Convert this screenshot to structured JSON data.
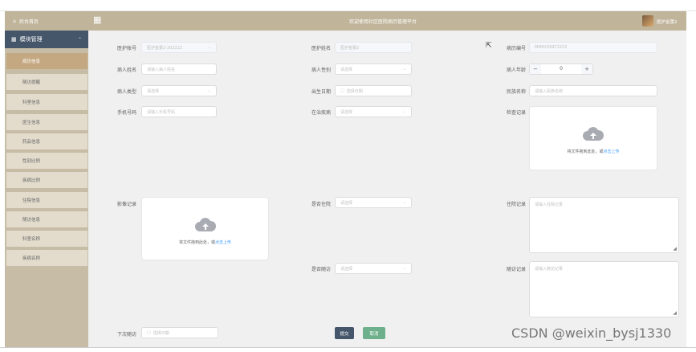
{
  "sidebar": {
    "home_label": "后台首页",
    "module_label": "模块管理",
    "items": [
      {
        "label": "病历信息",
        "active": true
      },
      {
        "label": "随访提醒",
        "active": false
      },
      {
        "label": "科室信息",
        "active": false
      },
      {
        "label": "医生信息",
        "active": false
      },
      {
        "label": "药品信息",
        "active": false
      },
      {
        "label": "性别比例",
        "active": false
      },
      {
        "label": "疾病比例",
        "active": false
      },
      {
        "label": "住院信息",
        "active": false
      },
      {
        "label": "随访信息",
        "active": false
      },
      {
        "label": "科室名称",
        "active": false
      },
      {
        "label": "疾病名称",
        "active": false
      }
    ]
  },
  "header": {
    "title": "欢迎使用社区医院病历管理平台",
    "user": "医护金蕾2"
  },
  "form": {
    "nurse_account": {
      "label": "医护账号",
      "value": "医护金蕾2-202222"
    },
    "nurse_name": {
      "label": "医护姓名",
      "value": "医护金蕾2"
    },
    "record_no": {
      "label": "病历编号",
      "value": "MM4259972222"
    },
    "patient_name": {
      "label": "病人姓名",
      "placeholder": "请输入病人姓名"
    },
    "patient_gender": {
      "label": "病人性别",
      "placeholder": "请选择"
    },
    "patient_age": {
      "label": "病人年龄",
      "value": "0",
      "minus": "−",
      "plus": "+"
    },
    "patient_type": {
      "label": "病人类型",
      "placeholder": "请选择"
    },
    "birth_date": {
      "label": "出生日期",
      "placeholder": "选择日期"
    },
    "ethnicity": {
      "label": "民族名称",
      "placeholder": "请输入民族名称"
    },
    "phone": {
      "label": "手机号码",
      "placeholder": "请输入手机号码"
    },
    "disease": {
      "label": "在治疾病",
      "placeholder": "请选择"
    },
    "exam_record": {
      "label": "检查记录",
      "upload_text": "将文件拖到此处，或",
      "upload_link": "点击上传"
    },
    "image_record": {
      "label": "影像记录",
      "upload_text": "将文件拖到此处，或",
      "upload_link": "点击上传"
    },
    "is_hospitalized": {
      "label": "是否住院",
      "placeholder": "请选择"
    },
    "hospital_record": {
      "label": "住院记录",
      "placeholder": "请输入住院记录"
    },
    "is_followup": {
      "label": "是否随访",
      "placeholder": "请选择"
    },
    "followup_record": {
      "label": "随访记录",
      "placeholder": "请输入随访记录"
    },
    "next_followup": {
      "label": "下次随访",
      "placeholder": "选择日期"
    },
    "submit_label": "提交",
    "cancel_label": "取消"
  },
  "icons": {
    "home": "home-icon",
    "grid": "grid-icon",
    "chevron": "chevron-up-icon",
    "caret": "chevron-down-icon",
    "calendar": "calendar-icon",
    "cloud": "cloud-upload-icon"
  },
  "colors": {
    "sidebar_bg": "#c7bda6",
    "menu_head": "#45556a",
    "active_item": "#c4a881",
    "topbar": "#c0b59b",
    "submit": "#45556a",
    "cancel": "#6fb08c",
    "link": "#409eff"
  },
  "watermark": "CSDN @weixin_bysj1330"
}
